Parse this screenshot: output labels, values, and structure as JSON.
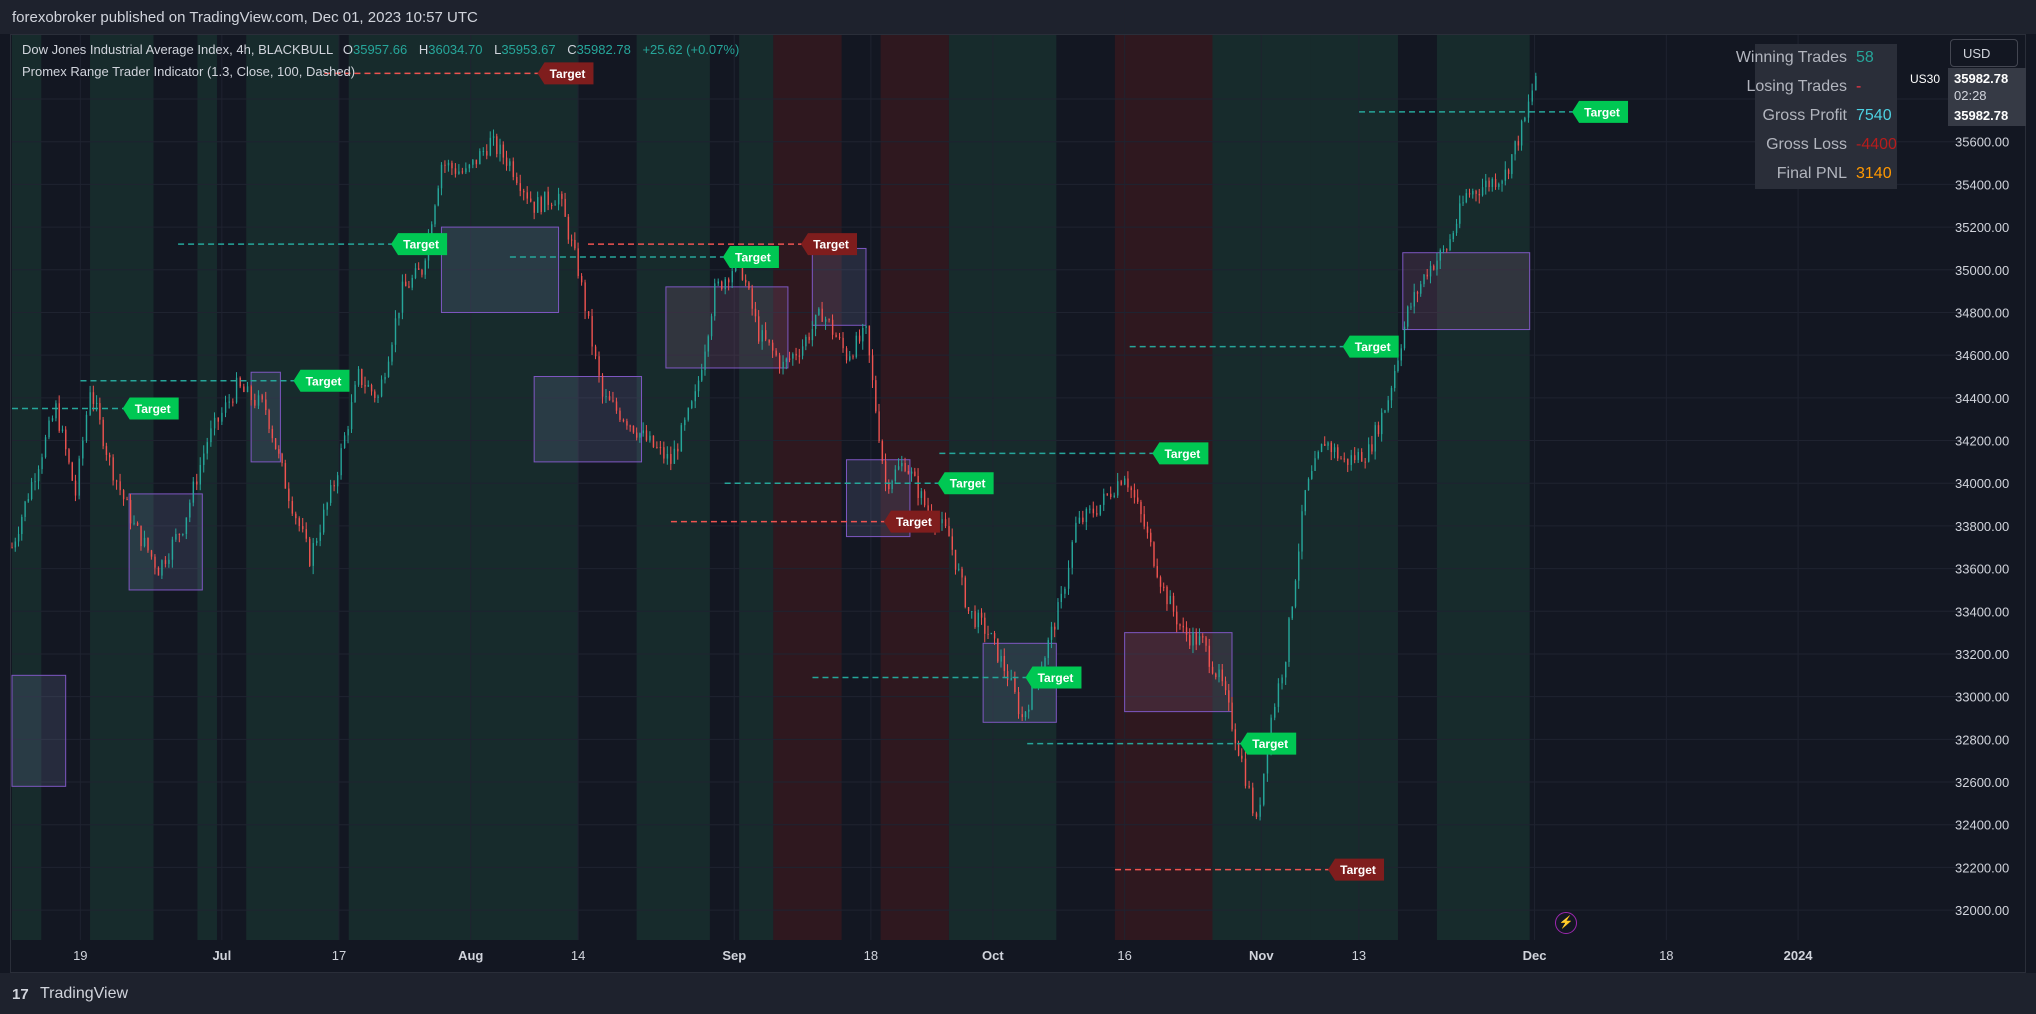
{
  "header": {
    "published_by": "forexobroker published on TradingView.com, Dec 01, 2023 10:57 UTC"
  },
  "legend": {
    "symbol_line": "Dow Jones Industrial Average Index, 4h, BLACKBULL",
    "open_label": "O",
    "open": "35957.66",
    "high_label": "H",
    "high": "36034.70",
    "low_label": "L",
    "low": "35953.67",
    "close_label": "C",
    "close": "35982.78",
    "change": "+25.62 (+0.07%)",
    "indicator": "Promex Range Trader Indicator (1.3, Close, 100, Dashed)"
  },
  "stats": [
    {
      "label": "Winning Trades",
      "value": "58",
      "color": "#26a69a"
    },
    {
      "label": "Losing Trades",
      "value": "-",
      "color": "#f23645"
    },
    {
      "label": "Gross Profit",
      "value": "7540",
      "color": "#4dd0e1"
    },
    {
      "label": "Gross Loss",
      "value": "-4400",
      "color": "#b71c1c"
    },
    {
      "label": "Final PNL",
      "value": "3140",
      "color": "#ff9800"
    }
  ],
  "currency_button": "USD",
  "price_tag": {
    "ticker": "US30",
    "price": "35982.78",
    "countdown": "02:28",
    "last": "35982.78"
  },
  "price_axis": [
    "35800.00",
    "35600.00",
    "35400.00",
    "35200.00",
    "35000.00",
    "34800.00",
    "34600.00",
    "34400.00",
    "34200.00",
    "34000.00",
    "33800.00",
    "33600.00",
    "33400.00",
    "33200.00",
    "33000.00",
    "32800.00",
    "32600.00",
    "32400.00",
    "32200.00",
    "32000.00"
  ],
  "time_axis": [
    "19",
    "Jul",
    "17",
    "Aug",
    "14",
    "Sep",
    "18",
    "Oct",
    "16",
    "Nov",
    "13",
    "Dec",
    "18",
    "2024"
  ],
  "target_label": "Target",
  "footer": {
    "brand": "TradingView",
    "logo": "17"
  },
  "chart_data": {
    "type": "candlestick",
    "symbol": "US30",
    "timeframe": "4h",
    "y_axis_ticks": [
      32000,
      32200,
      32400,
      32600,
      32800,
      33000,
      33200,
      33400,
      33600,
      33800,
      34000,
      34200,
      34400,
      34600,
      34800,
      35000,
      35200,
      35400,
      35600,
      35800
    ],
    "x_axis_ticks": [
      "19",
      "Jul",
      "17",
      "Aug",
      "14",
      "Sep",
      "18",
      "Oct",
      "16",
      "Nov",
      "13",
      "Dec",
      "18",
      "2024"
    ],
    "price_path": [
      [
        0,
        33700
      ],
      [
        0.4,
        34000
      ],
      [
        0.9,
        34350
      ],
      [
        1.3,
        33950
      ],
      [
        1.6,
        34450
      ],
      [
        2,
        34100
      ],
      [
        2.5,
        33800
      ],
      [
        3,
        33600
      ],
      [
        3.5,
        33800
      ],
      [
        4,
        34200
      ],
      [
        4.6,
        34450
      ],
      [
        5.2,
        34350
      ],
      [
        5.6,
        34000
      ],
      [
        6.1,
        33650
      ],
      [
        6.6,
        34000
      ],
      [
        7.1,
        34500
      ],
      [
        7.5,
        34400
      ],
      [
        8,
        34900
      ],
      [
        8.4,
        35000
      ],
      [
        8.8,
        35500
      ],
      [
        9.3,
        35450
      ],
      [
        9.8,
        35600
      ],
      [
        10.2,
        35500
      ],
      [
        10.7,
        35300
      ],
      [
        11.2,
        35350
      ],
      [
        11.6,
        35000
      ],
      [
        12.1,
        34400
      ],
      [
        12.6,
        34300
      ],
      [
        13,
        34200
      ],
      [
        13.5,
        34100
      ],
      [
        14,
        34400
      ],
      [
        14.4,
        34900
      ],
      [
        14.9,
        35050
      ],
      [
        15.3,
        34700
      ],
      [
        15.8,
        34550
      ],
      [
        16.2,
        34650
      ],
      [
        16.6,
        34800
      ],
      [
        17.1,
        34600
      ],
      [
        17.5,
        34700
      ],
      [
        17.9,
        34000
      ],
      [
        18.3,
        34100
      ],
      [
        18.7,
        33900
      ],
      [
        19.2,
        33750
      ],
      [
        19.6,
        33400
      ],
      [
        20,
        33300
      ],
      [
        20.4,
        33100
      ],
      [
        20.7,
        32900
      ],
      [
        21.1,
        33150
      ],
      [
        21.5,
        33450
      ],
      [
        21.8,
        33800
      ],
      [
        22.3,
        33900
      ],
      [
        22.8,
        34050
      ],
      [
        23.2,
        33800
      ],
      [
        23.6,
        33500
      ],
      [
        24,
        33300
      ],
      [
        24.4,
        33250
      ],
      [
        24.8,
        33050
      ],
      [
        25.2,
        32700
      ],
      [
        25.5,
        32400
      ],
      [
        25.8,
        32900
      ],
      [
        26.1,
        33200
      ],
      [
        26.5,
        33950
      ],
      [
        26.9,
        34200
      ],
      [
        27.3,
        34100
      ],
      [
        27.8,
        34150
      ],
      [
        28.2,
        34400
      ],
      [
        28.6,
        34800
      ],
      [
        29,
        35000
      ],
      [
        29.4,
        35100
      ],
      [
        29.8,
        35350
      ],
      [
        30.2,
        35400
      ],
      [
        30.6,
        35450
      ],
      [
        31,
        35700
      ],
      [
        31.3,
        35982.78
      ]
    ],
    "range_boxes": [
      {
        "t1": 0,
        "t2": 1.1,
        "high": 33100,
        "low": 32580,
        "color": "blue"
      },
      {
        "t1": 2.4,
        "t2": 3.9,
        "high": 33950,
        "low": 33500,
        "color": "blue"
      },
      {
        "t1": 4.9,
        "t2": 5.5,
        "high": 34520,
        "low": 34100,
        "color": "blue"
      },
      {
        "t1": 8.8,
        "t2": 11.2,
        "high": 35200,
        "low": 34800,
        "color": "blue"
      },
      {
        "t1": 10.7,
        "t2": 12.9,
        "high": 34500,
        "low": 34100,
        "color": "blue"
      },
      {
        "t1": 13.4,
        "t2": 15.9,
        "high": 34920,
        "low": 34540,
        "color": "red"
      },
      {
        "t1": 16.4,
        "t2": 17.5,
        "high": 35100,
        "low": 34740,
        "color": "blue"
      },
      {
        "t1": 17.1,
        "t2": 18.4,
        "high": 34110,
        "low": 33750,
        "color": "blue"
      },
      {
        "t1": 19.9,
        "t2": 21.4,
        "high": 33250,
        "low": 32880,
        "color": "blue"
      },
      {
        "t1": 22.8,
        "t2": 25.0,
        "high": 33300,
        "low": 32930,
        "color": "red"
      },
      {
        "t1": 28.5,
        "t2": 31.1,
        "high": 35080,
        "low": 34720,
        "color": "red"
      }
    ],
    "targets": [
      {
        "t": 1.1,
        "price": 34350,
        "side": "long"
      },
      {
        "t": 4.6,
        "price": 34480,
        "side": "long"
      },
      {
        "t": 6.6,
        "price": 35120,
        "side": "long"
      },
      {
        "t": 9.6,
        "price": 35920,
        "side": "short"
      },
      {
        "t": 13.4,
        "price": 35060,
        "side": "long"
      },
      {
        "t": 15.0,
        "price": 35120,
        "side": "short"
      },
      {
        "t": 16.7,
        "price": 33820,
        "side": "short"
      },
      {
        "t": 17.8,
        "price": 34000,
        "side": "long"
      },
      {
        "t": 19.6,
        "price": 33090,
        "side": "long"
      },
      {
        "t": 22.2,
        "price": 34140,
        "side": "long"
      },
      {
        "t": 24.0,
        "price": 32780,
        "side": "long"
      },
      {
        "t": 25.8,
        "price": 32190,
        "side": "short"
      },
      {
        "t": 26.1,
        "price": 34640,
        "side": "long"
      },
      {
        "t": 30.8,
        "price": 35740,
        "side": "long"
      }
    ],
    "grid": true
  }
}
